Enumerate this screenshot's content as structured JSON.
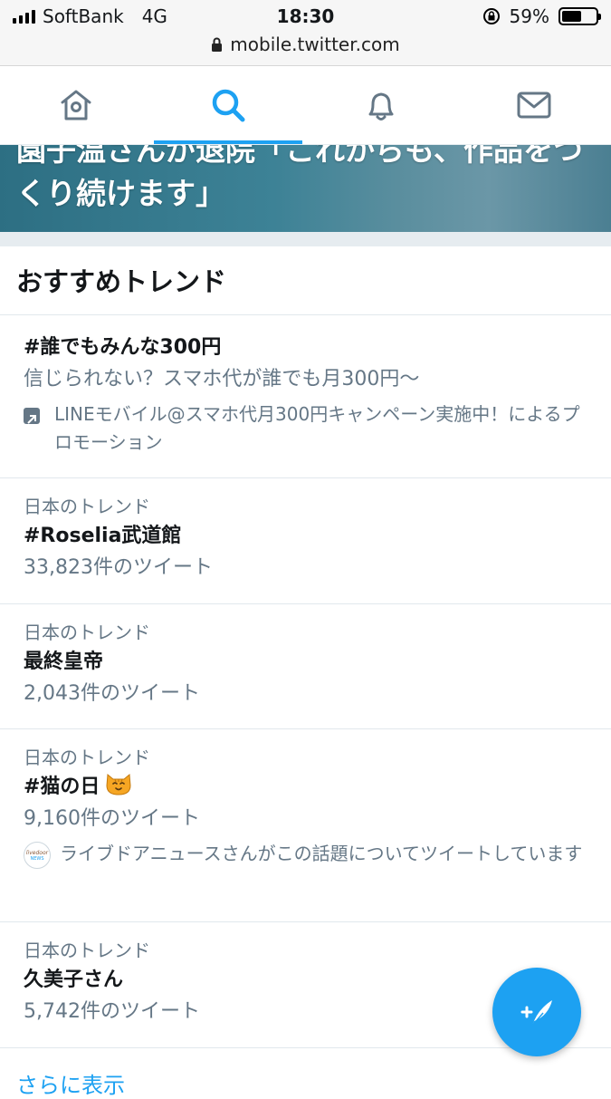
{
  "status_bar": {
    "carrier": "SoftBank",
    "network": "4G",
    "time": "18:30",
    "battery": "59%",
    "battery_level": 0.59,
    "url": "mobile.twitter.com"
  },
  "tabs": [
    {
      "name": "home",
      "icon": "home-icon"
    },
    {
      "name": "search",
      "icon": "search-icon",
      "active": true
    },
    {
      "name": "notifications",
      "icon": "bell-icon"
    },
    {
      "name": "messages",
      "icon": "envelope-icon"
    }
  ],
  "hero": {
    "headline": "園子温さんが退院「これからも、作品をつくり続けます」"
  },
  "trends": {
    "title": "おすすめトレンド",
    "items": [
      {
        "name": "#誰でもみんな300円",
        "description": "信じられない？スマホ代が誰でも月300円〜",
        "promo": "LINEモバイル@スマホ代月300円キャンペーン実施中！によるプロモーション"
      },
      {
        "context": "日本のトレンド",
        "name": "#Roselia武道館",
        "count": "33,823件のツイート"
      },
      {
        "context": "日本のトレンド",
        "name": "最終皇帝",
        "count": "2,043件のツイート"
      },
      {
        "context": "日本のトレンド",
        "name": "#猫の日",
        "emoji": "cat-face-emoji",
        "count": "9,160件のツイート",
        "social": "ライブドアニュースさんがこの話題についてツイートしています",
        "social_avatar": "livedoor NEWS"
      },
      {
        "context": "日本のトレンド",
        "name": "久美子さん",
        "count": "5,742件のツイート"
      }
    ],
    "more_label": "さらに表示"
  },
  "colors": {
    "accent": "#1da1f2",
    "secondary_text": "#657786",
    "divider": "#e6ecf0"
  }
}
